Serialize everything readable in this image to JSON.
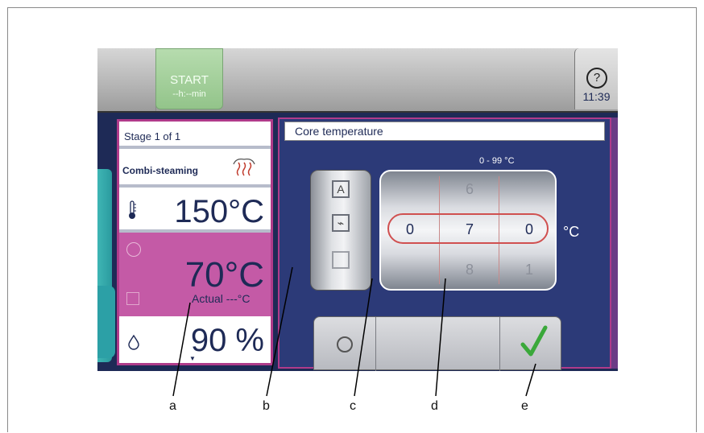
{
  "topbar": {
    "start_label": "START",
    "start_time": "--h:--min",
    "help_label": "?",
    "clock": "11:39"
  },
  "left_panel": {
    "stage": "Stage  1  of  1",
    "mode": "Combi-steaming",
    "cabinet_temp": "150°C",
    "core_temp": "70°C",
    "actual": "Actual ---°C",
    "humidity": "90 %"
  },
  "right_panel": {
    "title": "Core temperature",
    "range": "0 - 99 °C",
    "wheel_top": [
      "",
      "6",
      ""
    ],
    "wheel_selected": [
      "0",
      "7",
      "0"
    ],
    "wheel_bottom": [
      "",
      "8",
      "1"
    ],
    "unit": "°C"
  },
  "callouts": [
    "a",
    "b",
    "c",
    "d",
    "e"
  ],
  "colors": {
    "accent": "#c45aa6",
    "navy": "#1e2a56",
    "start_green": "#9ccc93",
    "check_green": "#3aa83a"
  }
}
